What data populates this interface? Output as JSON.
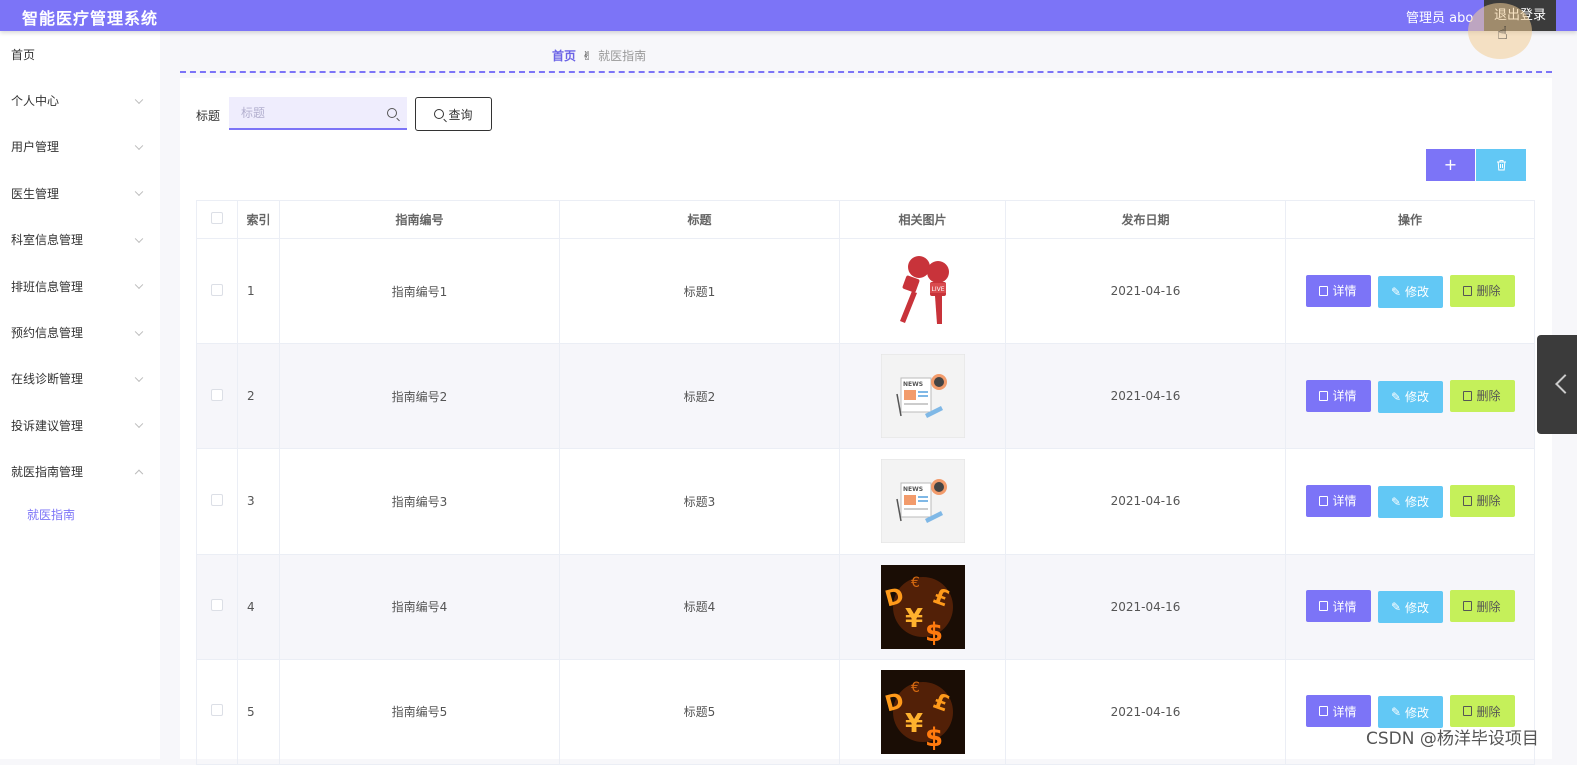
{
  "header": {
    "title": "智能医疗管理系统",
    "user": "管理员 abo",
    "logout": "退出登录"
  },
  "sidebar": {
    "items": [
      {
        "label": "首页",
        "chevron": false
      },
      {
        "label": "个人中心",
        "chevron": true
      },
      {
        "label": "用户管理",
        "chevron": true
      },
      {
        "label": "医生管理",
        "chevron": true
      },
      {
        "label": "科室信息管理",
        "chevron": true
      },
      {
        "label": "排班信息管理",
        "chevron": true
      },
      {
        "label": "预约信息管理",
        "chevron": true
      },
      {
        "label": "在线诊断管理",
        "chevron": true
      },
      {
        "label": "投诉建议管理",
        "chevron": true
      },
      {
        "label": "就医指南管理",
        "chevron": true,
        "expanded": true
      }
    ],
    "submenu": {
      "label": "就医指南"
    }
  },
  "breadcrumb": {
    "home": "首页",
    "separator": "✌",
    "current": "就医指南"
  },
  "search": {
    "label": "标题",
    "placeholder": "标题",
    "button": "查询"
  },
  "toolbar": {
    "add": "+"
  },
  "table": {
    "headers": {
      "index": "索引",
      "code": "指南编号",
      "title": "标题",
      "image": "相关图片",
      "date": "发布日期",
      "ops": "操作"
    },
    "rows": [
      {
        "index": "1",
        "code": "指南编号1",
        "title": "标题1",
        "image": "microphone-live-icon",
        "date": "2021-04-16"
      },
      {
        "index": "2",
        "code": "指南编号2",
        "title": "标题2",
        "image": "news-paper-icon",
        "date": "2021-04-16"
      },
      {
        "index": "3",
        "code": "指南编号3",
        "title": "标题3",
        "image": "news-paper-icon",
        "date": "2021-04-16"
      },
      {
        "index": "4",
        "code": "指南编号4",
        "title": "标题4",
        "image": "currency-neon-image",
        "date": "2021-04-16"
      },
      {
        "index": "5",
        "code": "指南编号5",
        "title": "标题5",
        "image": "currency-neon-image",
        "date": "2021-04-16"
      }
    ],
    "actions": {
      "detail": "详情",
      "edit": "修改",
      "delete": "删除"
    }
  },
  "watermark": "CSDN @杨洋毕设项目",
  "colors": {
    "primary": "#7c74f7",
    "info": "#62c8f5",
    "lime": "#c5f05a",
    "dark": "#3b3b3b"
  }
}
